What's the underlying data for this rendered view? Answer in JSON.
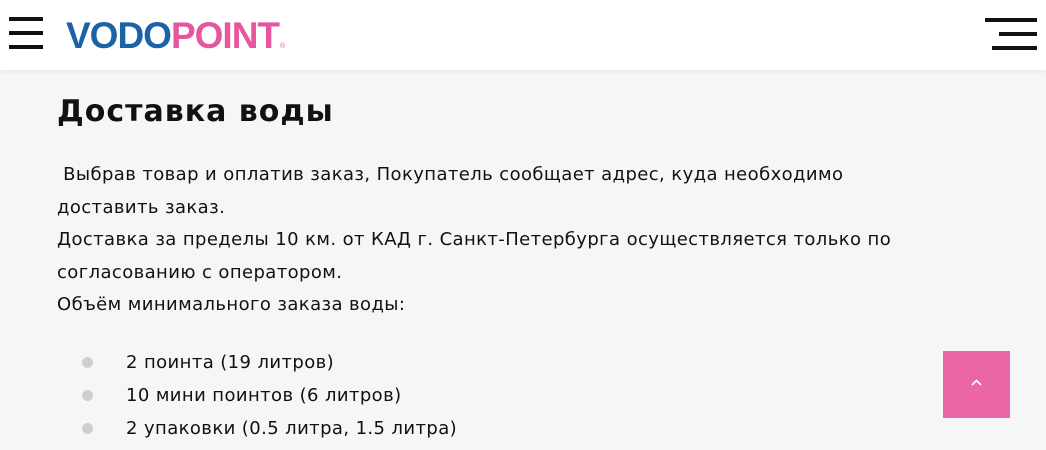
{
  "header": {
    "logo": {
      "part1": "VODO",
      "part2": "POINT",
      "mark": "®"
    },
    "menu_icon": "hamburger-icon",
    "nav_icon": "menu-lines-icon"
  },
  "main": {
    "title": "Доставка воды",
    "paragraphs": [
      " Выбрав товар и оплатив заказ, Покупатель сообщает адрес, куда необходимо доставить заказ.",
      "Доставка за пределы 10 км. от КАД г. Санкт-Петербурга осуществляется только по согласованию с оператором.",
      "Объём минимального заказа воды:"
    ],
    "list": [
      "2 поинта (19 литров)",
      "10 мини поинтов (6 литров)",
      "2 упаковки (0.5 литра, 1.5 литра)"
    ]
  },
  "scroll_top": {
    "icon": "chevron-up-icon"
  },
  "colors": {
    "brand_blue": "#1b62a6",
    "brand_pink": "#e6559d",
    "scroll_button": "#ea66a6"
  }
}
